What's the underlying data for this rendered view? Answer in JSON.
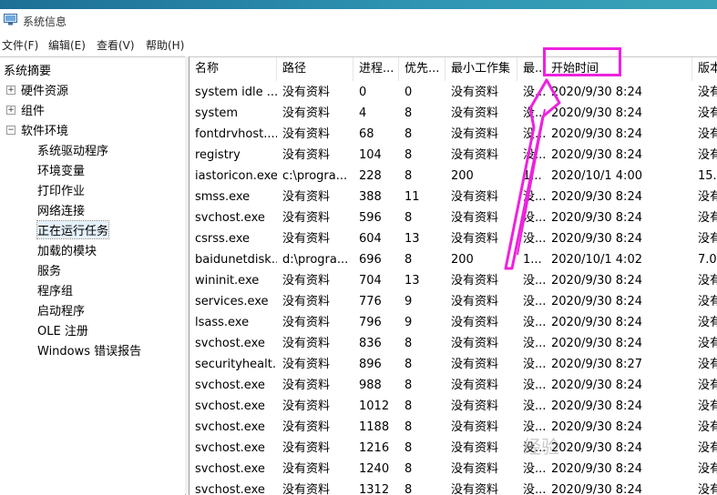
{
  "window": {
    "title": "系统信息"
  },
  "menu": [
    "文件(F)",
    "编辑(E)",
    "查看(V)",
    "帮助(H)"
  ],
  "tree": {
    "root": "系统摘要",
    "nodes": [
      {
        "label": "硬件资源",
        "expander": "+"
      },
      {
        "label": "组件",
        "expander": "+"
      },
      {
        "label": "软件环境",
        "expander": "−"
      }
    ],
    "software_children": [
      "系统驱动程序",
      "环境变量",
      "打印作业",
      "网络连接",
      "正在运行任务",
      "加载的模块",
      "服务",
      "程序组",
      "启动程序",
      "OLE 注册",
      "Windows 错误报告"
    ],
    "selected": "正在运行任务"
  },
  "columns": [
    "名称",
    "路径",
    "进程...",
    "优先...",
    "最小工作集",
    "最...",
    "开始时间",
    "版本"
  ],
  "rows": [
    [
      "system idle ...",
      "没有资料",
      "0",
      "0",
      "没有资料",
      "没...",
      "2020/9/30 8:24",
      "没有"
    ],
    [
      "system",
      "没有资料",
      "4",
      "8",
      "没有资料",
      "没...",
      "2020/9/30 8:24",
      "没有"
    ],
    [
      "fontdrvhost....",
      "没有资料",
      "68",
      "8",
      "没有资料",
      "没...",
      "2020/9/30 8:24",
      "没有"
    ],
    [
      "registry",
      "没有资料",
      "104",
      "8",
      "没有资料",
      "没...",
      "2020/9/30 8:24",
      "没有"
    ],
    [
      "iastoricon.exe",
      "c:\\progra...",
      "228",
      "8",
      "200",
      "1...",
      "2020/10/1 4:00",
      "15."
    ],
    [
      "smss.exe",
      "没有资料",
      "388",
      "11",
      "没有资料",
      "没...",
      "2020/9/30 8:24",
      "没有"
    ],
    [
      "svchost.exe",
      "没有资料",
      "596",
      "8",
      "没有资料",
      "没...",
      "2020/9/30 8:24",
      "没有"
    ],
    [
      "csrss.exe",
      "没有资料",
      "604",
      "13",
      "没有资料",
      "没...",
      "2020/9/30 8:24",
      "没有"
    ],
    [
      "baidunetdisk...",
      "d:\\progra...",
      "696",
      "8",
      "200",
      "1...",
      "2020/10/1 4:02",
      "7.0"
    ],
    [
      "wininit.exe",
      "没有资料",
      "704",
      "13",
      "没有资料",
      "没...",
      "2020/9/30 8:24",
      "没有"
    ],
    [
      "services.exe",
      "没有资料",
      "776",
      "9",
      "没有资料",
      "没...",
      "2020/9/30 8:24",
      "没有"
    ],
    [
      "lsass.exe",
      "没有资料",
      "796",
      "9",
      "没有资料",
      "没...",
      "2020/9/30 8:24",
      "没有"
    ],
    [
      "svchost.exe",
      "没有资料",
      "836",
      "8",
      "没有资料",
      "没...",
      "2020/9/30 8:24",
      "没有"
    ],
    [
      "securityhealt...",
      "没有资料",
      "896",
      "8",
      "没有资料",
      "没...",
      "2020/9/30 8:27",
      "没有"
    ],
    [
      "svchost.exe",
      "没有资料",
      "988",
      "8",
      "没有资料",
      "没...",
      "2020/9/30 8:24",
      "没有"
    ],
    [
      "svchost.exe",
      "没有资料",
      "1012",
      "8",
      "没有资料",
      "没...",
      "2020/9/30 8:24",
      "没有"
    ],
    [
      "svchost.exe",
      "没有资料",
      "1188",
      "8",
      "没有资料",
      "没...",
      "2020/9/30 8:24",
      "没有"
    ],
    [
      "svchost.exe",
      "没有资料",
      "1216",
      "8",
      "没有资料",
      "没...",
      "2020/9/30 8:24",
      "没有"
    ],
    [
      "svchost.exe",
      "没有资料",
      "1240",
      "8",
      "没有资料",
      "没...",
      "2020/9/30 8:24",
      "没有"
    ],
    [
      "svchost.exe",
      "没有资料",
      "1312",
      "8",
      "没有资料",
      "没...",
      "2020/9/30 8:24",
      "没有"
    ]
  ],
  "annotation": {
    "color": "#ee22dd",
    "target": "开始时间"
  },
  "watermark": "经验"
}
